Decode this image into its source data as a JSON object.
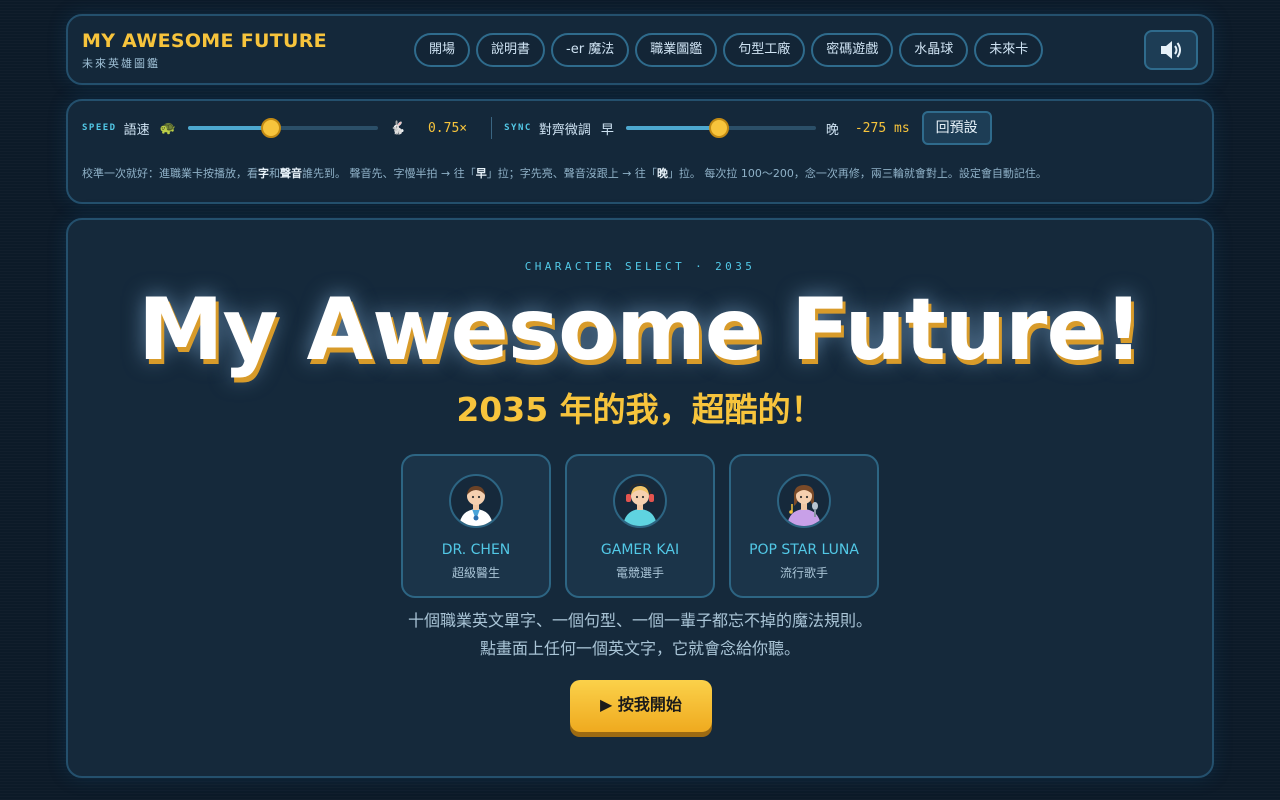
{
  "header": {
    "title": "MY AWESOME FUTURE",
    "subtitle": "未來英雄圖鑑",
    "nav": [
      "開場",
      "說明書",
      "-er 魔法",
      "職業圖鑑",
      "句型工廠",
      "密碼遊戲",
      "水晶球",
      "未來卡"
    ],
    "sound_icon": "speaker-icon"
  },
  "controls": {
    "speed_tag": "SPEED",
    "speed_label": "語速",
    "speed_slow_icon": "🐢",
    "speed_fast_icon": "🐇",
    "speed_fraction": 0.44,
    "speed_value": "0.75×",
    "sync_tag": "SYNC",
    "sync_label": "對齊微調",
    "sync_early": "早",
    "sync_late": "晚",
    "sync_fraction": 0.49,
    "sync_value": "-275 ms",
    "reset_label": "回預設",
    "hint_parts": [
      "校準一次就好：進職業卡按播放，看",
      "字",
      "和",
      "聲音",
      "誰先到。 聲音先、字慢半拍 → 往「",
      "早",
      "」拉；字先亮、聲音沒跟上 → 往「",
      "晚",
      "」拉。 每次拉 100～200，念一次再修，兩三輪就會對上。設定會自動記住。"
    ]
  },
  "main": {
    "kicker": "CHARACTER SELECT · 2035",
    "title": "My Awesome Future!",
    "subtitle": "2035 年的我，超酷的！",
    "cards": [
      {
        "name": "DR. CHEN",
        "role": "超級醫生",
        "icon": "doctor-avatar"
      },
      {
        "name": "GAMER KAI",
        "role": "電競選手",
        "icon": "gamer-avatar"
      },
      {
        "name": "POP STAR LUNA",
        "role": "流行歌手",
        "icon": "popstar-avatar"
      }
    ],
    "desc_line1": "十個職業英文單字、一個句型、一個一輩子都忘不掉的魔法規則。",
    "desc_line2": "點畫面上任何一個英文字，它就會念給你聽。",
    "start_label": "▶ 按我開始"
  }
}
